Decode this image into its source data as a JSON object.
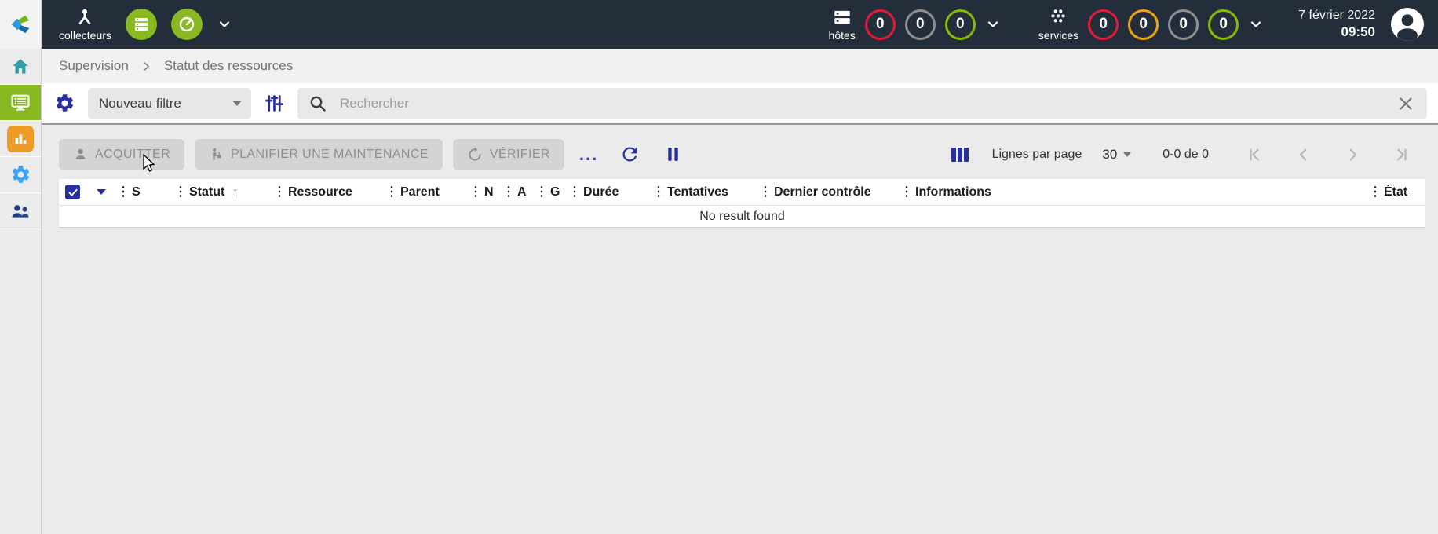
{
  "colors": {
    "topbar_bg": "#242d3a",
    "accent_blue": "#28309f",
    "brand_green": "#88b922",
    "status_red": "#e01b3d",
    "status_gray": "#8f8f8f",
    "status_green": "#84bd00",
    "status_orange": "#f0a310",
    "sidebar_home_teal": "#30a0a5",
    "sidebar_chart_orange": "#ee9c28",
    "sidebar_gear_blue": "#3da2f5",
    "sidebar_people_navy": "#21418d"
  },
  "topbar": {
    "pollers_label": "collecteurs",
    "hosts": {
      "label": "hôtes",
      "counters": [
        {
          "value": "0",
          "status": "red"
        },
        {
          "value": "0",
          "status": "gray"
        },
        {
          "value": "0",
          "status": "green"
        }
      ]
    },
    "services": {
      "label": "services",
      "counters": [
        {
          "value": "0",
          "status": "red"
        },
        {
          "value": "0",
          "status": "orange"
        },
        {
          "value": "0",
          "status": "gray"
        },
        {
          "value": "0",
          "status": "green"
        }
      ]
    },
    "date": "7 février 2022",
    "time": "09:50"
  },
  "breadcrumb": {
    "items": [
      {
        "label": "Supervision"
      },
      {
        "label": "Statut des ressources"
      }
    ]
  },
  "filter": {
    "saved_filter_value": "Nouveau filtre",
    "search_placeholder": "Rechercher"
  },
  "actions": {
    "acknowledge_label": "ACQUITTER",
    "downtime_label": "PLANIFIER UNE MAINTENANCE",
    "check_label": "VÉRIFIER",
    "more_label": "..."
  },
  "toolbar_right": {
    "rows_per_page_label": "Lignes par page",
    "rows_per_page_value": "30",
    "range_label": "0-0 de 0"
  },
  "table": {
    "columns": [
      "S",
      "Statut",
      "Ressource",
      "Parent",
      "N",
      "A",
      "G",
      "Durée",
      "Tentatives",
      "Dernier contrôle",
      "Informations",
      "État"
    ],
    "sorted_column": "Statut",
    "empty_message": "No result found"
  }
}
